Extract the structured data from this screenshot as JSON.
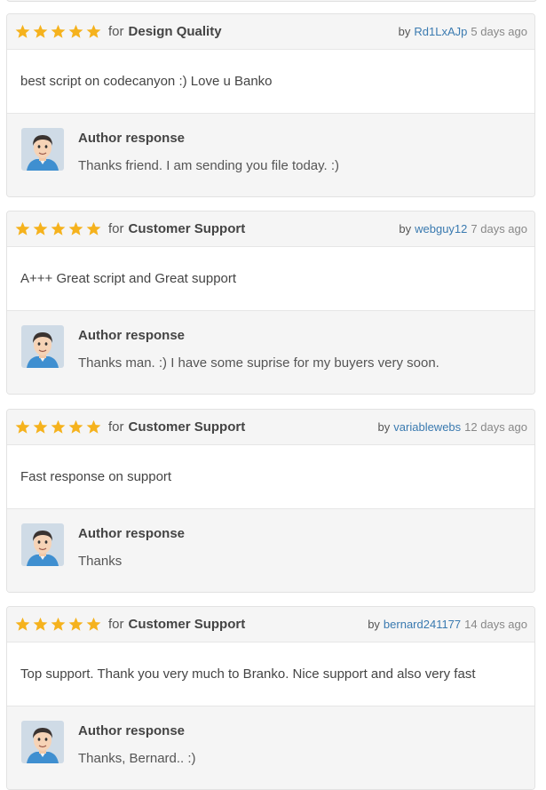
{
  "colors": {
    "star": "#f5b21d",
    "link": "#3a7ab0",
    "panel": "#f5f5f5"
  },
  "icons": {
    "rating_star": "star-icon",
    "author_avatar": "author-avatar"
  },
  "labels": {
    "for": "for",
    "by": "by",
    "author_response": "Author response"
  },
  "reviews": [
    {
      "rating": 5,
      "category": "Design Quality",
      "user": "Rd1LxAJp",
      "age": "5 days ago",
      "text": "best script on codecanyon :) Love u Banko",
      "response": "Thanks friend. I am sending you file today. :)"
    },
    {
      "rating": 5,
      "category": "Customer Support",
      "user": "webguy12",
      "age": "7 days ago",
      "text": "A+++ Great script and Great support",
      "response": "Thanks man. :) I have some suprise for my buyers very soon."
    },
    {
      "rating": 5,
      "category": "Customer Support",
      "user": "variablewebs",
      "age": "12 days ago",
      "text": "Fast response on support",
      "response": "Thanks"
    },
    {
      "rating": 5,
      "category": "Customer Support",
      "user": "bernard241177",
      "age": "14 days ago",
      "text": "Top support. Thank you very much to Branko. Nice support and also very fast",
      "response": "Thanks, Bernard.. :)"
    }
  ]
}
